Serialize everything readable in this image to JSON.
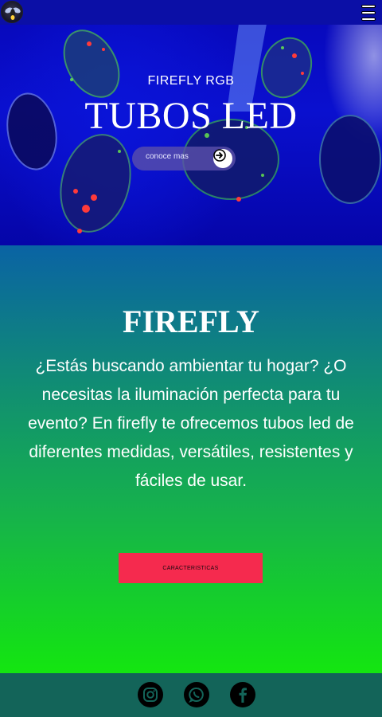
{
  "navbar": {
    "logo_icon": "firefly-logo-icon",
    "menu_icon": "hamburger-menu-icon"
  },
  "hero": {
    "subtitle": "FIREFLY RGB",
    "title": "TUBOS LED",
    "cta_label": "conoce mas",
    "cta_icon": "arrow-right-icon"
  },
  "info": {
    "title": "FIREFLY",
    "text": "¿Estás buscando ambientar tu hogar? ¿O necesitas la iluminación perfecta para tu evento? En firefly te ofrecemos tubos led de diferentes medidas, versátiles, resistentes y fáciles de usar.",
    "button_label": "CARACTERISTICAS"
  },
  "footer": {
    "social": [
      {
        "icon": "instagram-icon"
      },
      {
        "icon": "whatsapp-icon"
      },
      {
        "icon": "facebook-icon"
      }
    ]
  },
  "colors": {
    "hero_blue": "#0a10cf",
    "cta_red": "#f52a4e",
    "footer_teal": "#136459",
    "gradient_top": "#0a63a4",
    "gradient_bottom": "#14e610"
  }
}
